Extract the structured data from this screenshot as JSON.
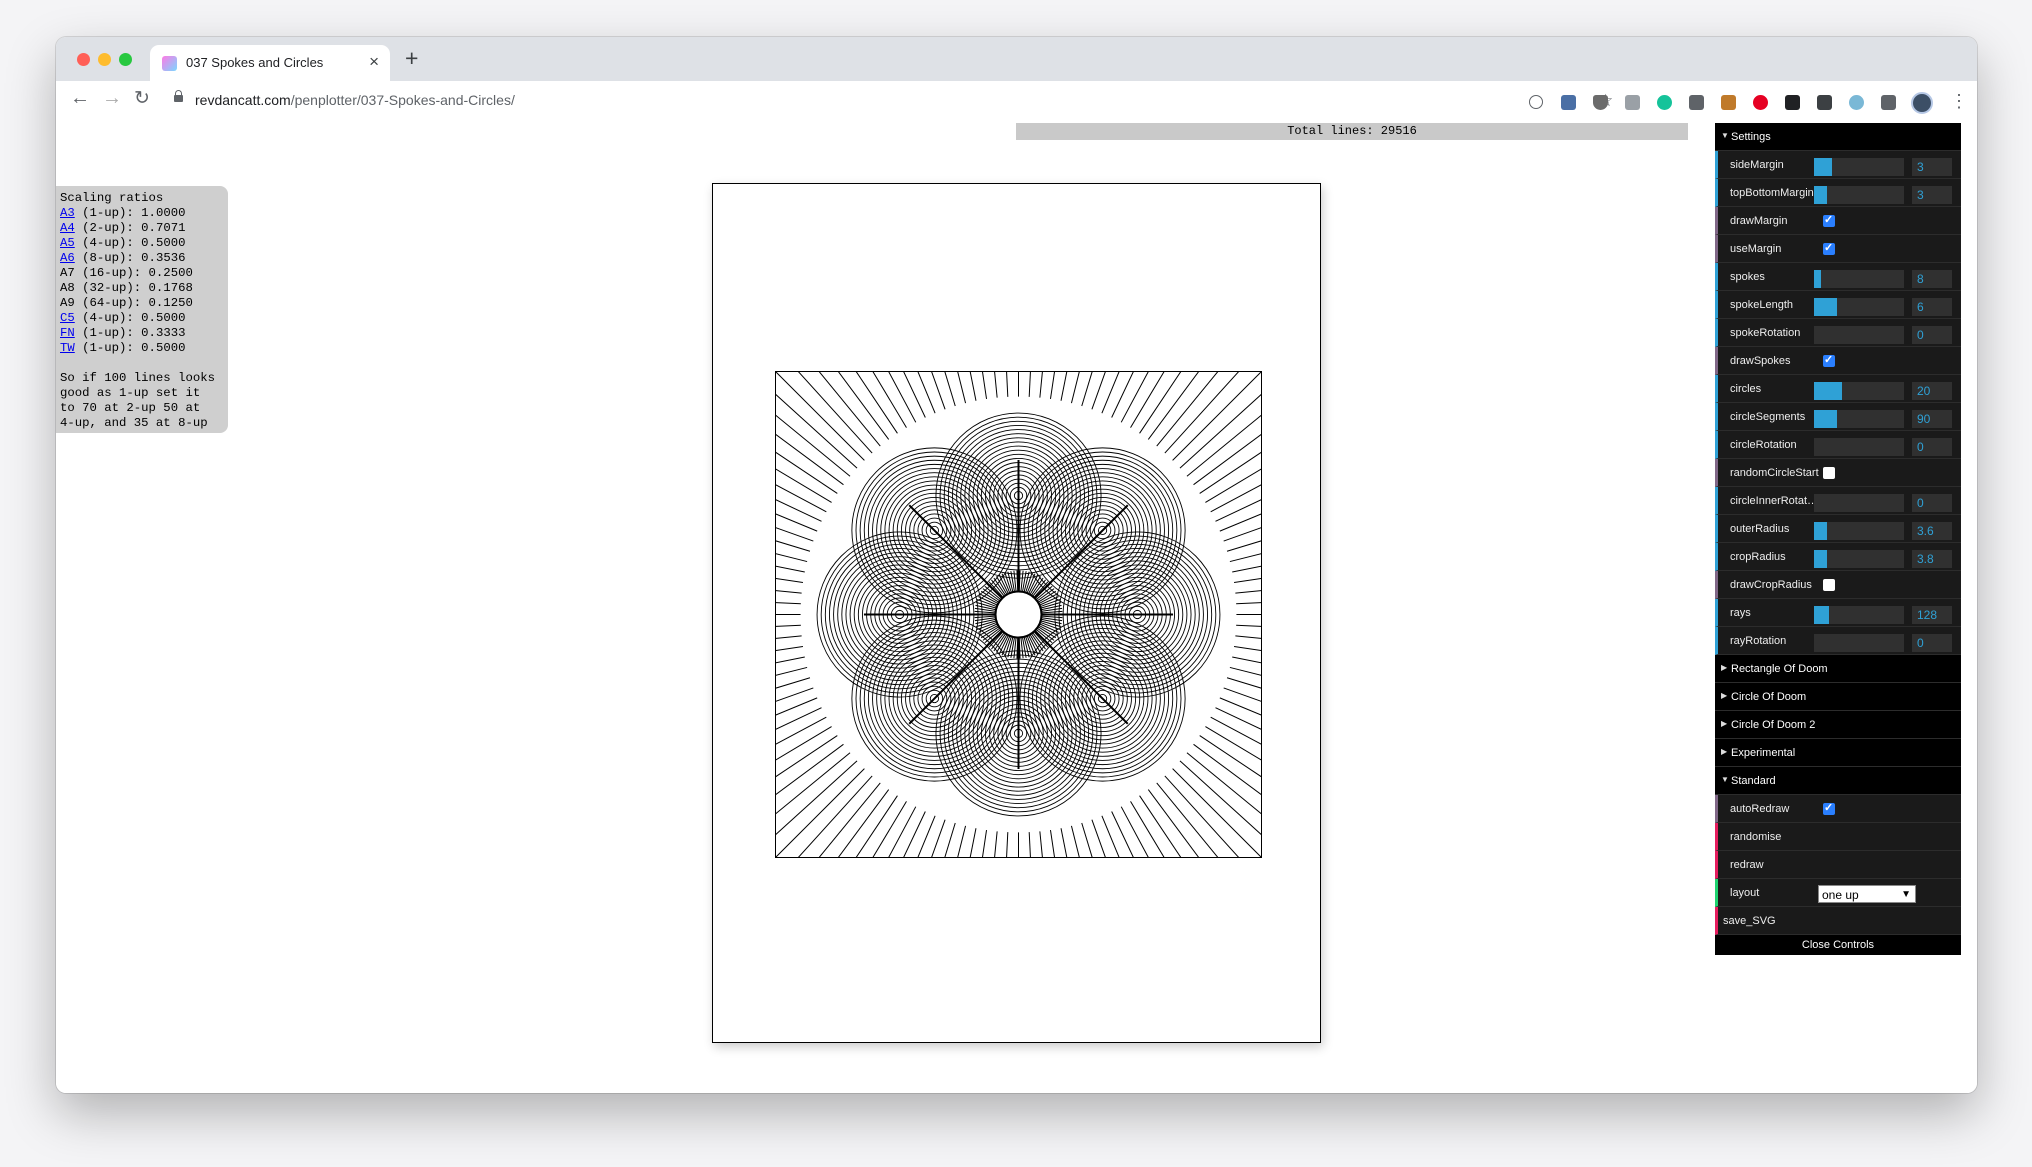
{
  "browser": {
    "tab_title": "037 Spokes and Circles",
    "url_host": "revdancatt.com",
    "url_path": "/penplotter/037-Spokes-and-Circles/"
  },
  "page": {
    "total_lines_label": "Total lines: 29516",
    "scaling": {
      "title": "Scaling ratios",
      "rows": [
        {
          "link": "A3",
          "rest": " (1-up): 1.0000"
        },
        {
          "link": "A4",
          "rest": " (2-up): 0.7071"
        },
        {
          "link": "A5",
          "rest": " (4-up): 0.5000"
        },
        {
          "link": "A6",
          "rest": " (8-up): 0.3536"
        },
        {
          "link": "",
          "rest": "A7 (16-up): 0.2500"
        },
        {
          "link": "",
          "rest": "A8 (32-up): 0.1768"
        },
        {
          "link": "",
          "rest": "A9 (64-up): 0.1250"
        },
        {
          "link": "C5",
          "rest": " (4-up): 0.5000"
        },
        {
          "link": "FN",
          "rest": " (1-up): 0.3333"
        },
        {
          "link": "TW",
          "rest": " (1-up): 0.5000"
        }
      ],
      "note": [
        "So if 100 lines looks",
        "good as 1-up set it",
        "to 70 at 2-up 50 at",
        "4-up, and 35 at 8-up"
      ]
    }
  },
  "controls": {
    "settings_folder": "Settings",
    "settings": [
      {
        "kind": "num",
        "label": "sideMargin",
        "value": "3",
        "fill": 0.2
      },
      {
        "kind": "num",
        "label": "topBottomMargin",
        "value": "3",
        "fill": 0.14
      },
      {
        "kind": "bool",
        "label": "drawMargin",
        "checked": true
      },
      {
        "kind": "bool",
        "label": "useMargin",
        "checked": true
      },
      {
        "kind": "num",
        "label": "spokes",
        "value": "8",
        "fill": 0.08
      },
      {
        "kind": "num",
        "label": "spokeLength",
        "value": "6",
        "fill": 0.25
      },
      {
        "kind": "num",
        "label": "spokeRotation",
        "value": "0",
        "fill": 0
      },
      {
        "kind": "bool",
        "label": "drawSpokes",
        "checked": true
      },
      {
        "kind": "num",
        "label": "circles",
        "value": "20",
        "fill": 0.31
      },
      {
        "kind": "num",
        "label": "circleSegments",
        "value": "90",
        "fill": 0.25
      },
      {
        "kind": "num",
        "label": "circleRotation",
        "value": "0",
        "fill": 0
      },
      {
        "kind": "bool",
        "label": "randomCircleStart",
        "checked": false
      },
      {
        "kind": "num",
        "label": "circleInnerRotation",
        "value": "0",
        "fill": 0
      },
      {
        "kind": "num",
        "label": "outerRadius",
        "value": "3.6",
        "fill": 0.14
      },
      {
        "kind": "num",
        "label": "cropRadius",
        "value": "3.8",
        "fill": 0.14
      },
      {
        "kind": "bool",
        "label": "drawCropRadius",
        "checked": false
      },
      {
        "kind": "num",
        "label": "rays",
        "value": "128",
        "fill": 0.17
      },
      {
        "kind": "num",
        "label": "rayRotation",
        "value": "0",
        "fill": 0
      }
    ],
    "collapsed_folders": [
      "Rectangle Of Doom",
      "Circle Of Doom",
      "Circle Of Doom 2",
      "Experimental"
    ],
    "standard_folder": "Standard",
    "autoRedraw_label": "autoRedraw",
    "randomise_label": "randomise",
    "redraw_label": "redraw",
    "layout_label": "layout",
    "layout_value": "one up",
    "save_svg_label": "save_SVG",
    "close_label": "Close Controls"
  }
}
